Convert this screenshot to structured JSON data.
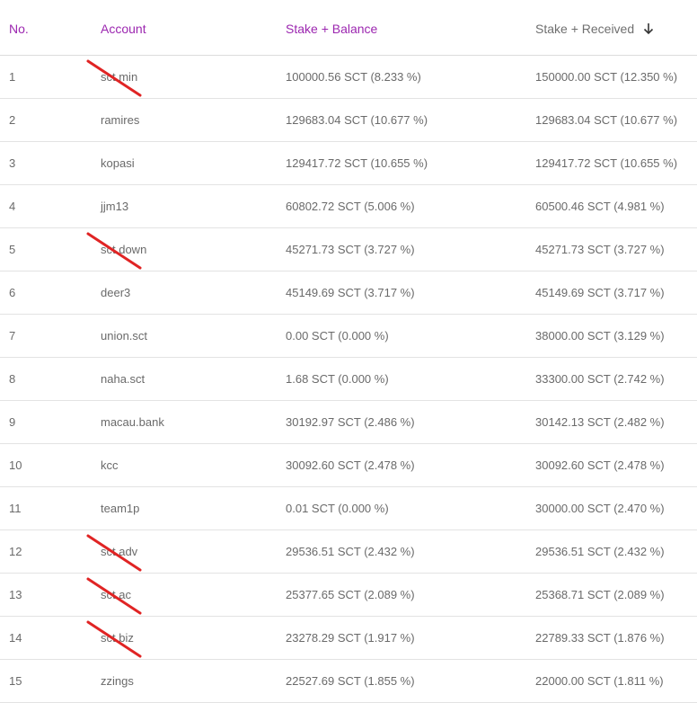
{
  "table": {
    "headers": {
      "no": "No.",
      "account": "Account",
      "stake_balance": "Stake + Balance",
      "stake_received": "Stake + Received"
    },
    "sort": {
      "column": "stake_received",
      "direction": "descending",
      "icon": "arrow-down-icon"
    },
    "colors": {
      "header_accent": "#9c27b0",
      "strike_mark": "#e02424"
    },
    "rows": [
      {
        "no": "1",
        "account": "sct.min",
        "stake_balance": "100000.56 SCT (8.233 %)",
        "stake_received": "150000.00 SCT (12.350 %)",
        "struck_out": true
      },
      {
        "no": "2",
        "account": "ramires",
        "stake_balance": "129683.04 SCT (10.677 %)",
        "stake_received": "129683.04 SCT (10.677 %)",
        "struck_out": false
      },
      {
        "no": "3",
        "account": "kopasi",
        "stake_balance": "129417.72 SCT (10.655 %)",
        "stake_received": "129417.72 SCT (10.655 %)",
        "struck_out": false
      },
      {
        "no": "4",
        "account": "jjm13",
        "stake_balance": "60802.72 SCT (5.006 %)",
        "stake_received": "60500.46 SCT (4.981 %)",
        "struck_out": false
      },
      {
        "no": "5",
        "account": "sct.down",
        "stake_balance": "45271.73 SCT (3.727 %)",
        "stake_received": "45271.73 SCT (3.727 %)",
        "struck_out": true
      },
      {
        "no": "6",
        "account": "deer3",
        "stake_balance": "45149.69 SCT (3.717 %)",
        "stake_received": "45149.69 SCT (3.717 %)",
        "struck_out": false
      },
      {
        "no": "7",
        "account": "union.sct",
        "stake_balance": "0.00 SCT (0.000 %)",
        "stake_received": "38000.00 SCT (3.129 %)",
        "struck_out": false
      },
      {
        "no": "8",
        "account": "naha.sct",
        "stake_balance": "1.68 SCT (0.000 %)",
        "stake_received": "33300.00 SCT (2.742 %)",
        "struck_out": false
      },
      {
        "no": "9",
        "account": "macau.bank",
        "stake_balance": "30192.97 SCT (2.486 %)",
        "stake_received": "30142.13 SCT (2.482 %)",
        "struck_out": false
      },
      {
        "no": "10",
        "account": "kcc",
        "stake_balance": "30092.60 SCT (2.478 %)",
        "stake_received": "30092.60 SCT (2.478 %)",
        "struck_out": false
      },
      {
        "no": "11",
        "account": "team1p",
        "stake_balance": "0.01 SCT (0.000 %)",
        "stake_received": "30000.00 SCT (2.470 %)",
        "struck_out": false
      },
      {
        "no": "12",
        "account": "sct.adv",
        "stake_balance": "29536.51 SCT (2.432 %)",
        "stake_received": "29536.51 SCT (2.432 %)",
        "struck_out": true
      },
      {
        "no": "13",
        "account": "sct.ac",
        "stake_balance": "25377.65 SCT (2.089 %)",
        "stake_received": "25368.71 SCT (2.089 %)",
        "struck_out": true
      },
      {
        "no": "14",
        "account": "sct.biz",
        "stake_balance": "23278.29 SCT (1.917 %)",
        "stake_received": "22789.33 SCT (1.876 %)",
        "struck_out": true
      },
      {
        "no": "15",
        "account": "zzings",
        "stake_balance": "22527.69 SCT (1.855 %)",
        "stake_received": "22000.00 SCT (1.811 %)",
        "struck_out": false
      }
    ]
  }
}
